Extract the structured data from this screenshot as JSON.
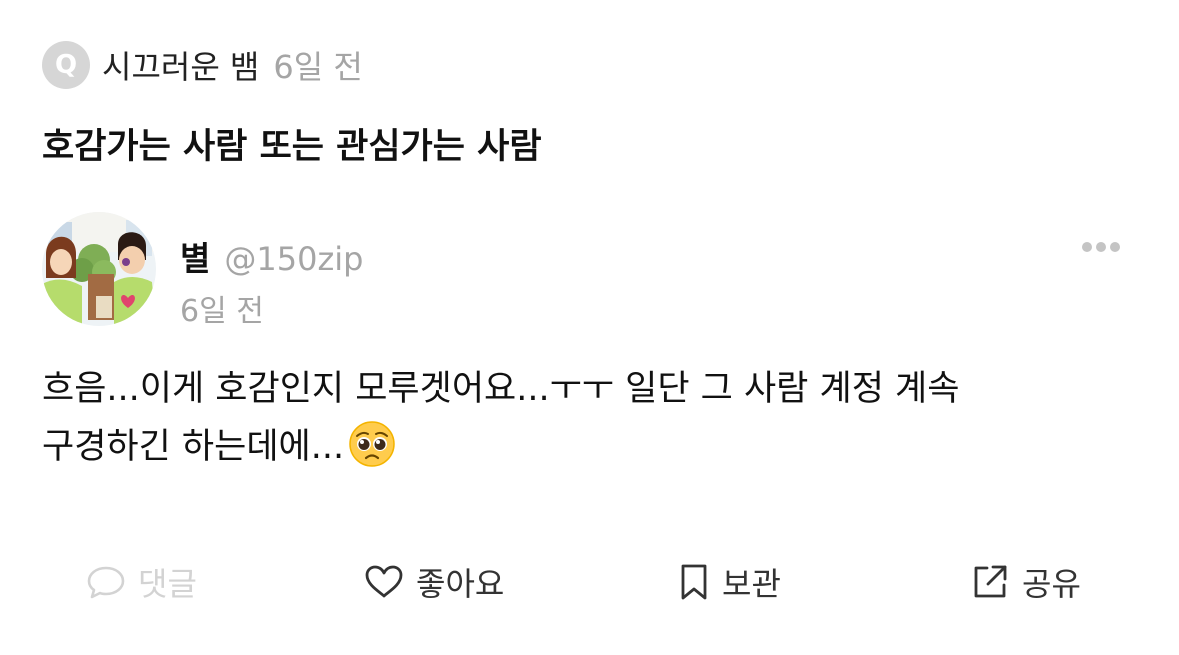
{
  "question": {
    "badge_letter": "Q",
    "author": "시끄러운 뱀",
    "time_ago": "6일 전",
    "title": "호감가는 사람 또는 관심가는 사람"
  },
  "answer": {
    "user_name": "별",
    "user_handle": "@150zip",
    "time_ago": "6일 전",
    "body_line1": "흐음...이게 호감인지 모루겟어요...ㅜㅜ 일단 그 사람 계정 계속",
    "body_line2": "구경하긴 하는데에...",
    "emoji": "pleading-face-emoji"
  },
  "actions": {
    "comment_label": "댓글",
    "like_label": "좋아요",
    "save_label": "보관",
    "share_label": "공유"
  },
  "icons": {
    "more": "more-horizontal-icon",
    "comment": "speech-bubble-icon",
    "like": "heart-icon",
    "save": "bookmark-icon",
    "share": "share-icon"
  },
  "colors": {
    "primary_text": "#111111",
    "muted_text": "#a5a5a5",
    "disabled": "#d3d3d3",
    "badge_bg": "#d6d6d6"
  }
}
